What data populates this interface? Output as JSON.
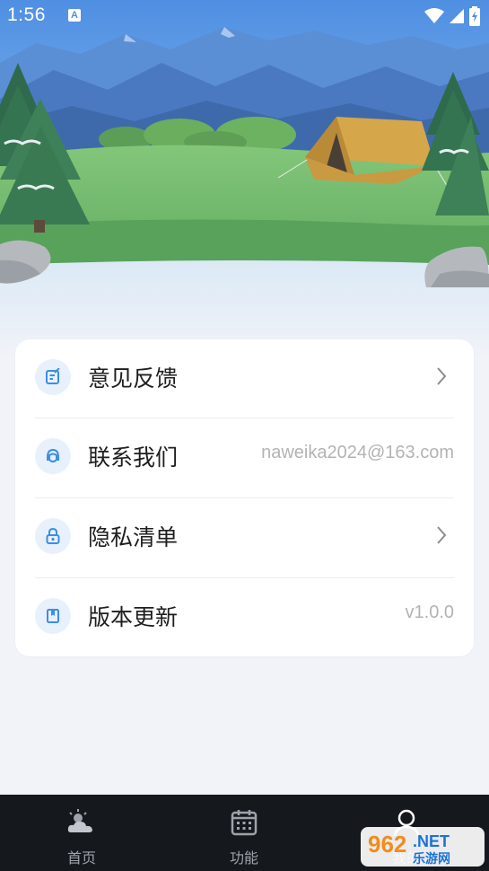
{
  "status": {
    "time": "1:56",
    "badge": "A"
  },
  "settings": {
    "items": [
      {
        "label": "意见反馈",
        "value": "",
        "icon": "feedback-edit-icon",
        "chevron": true
      },
      {
        "label": "联系我们",
        "value": "naweika2024@163.com",
        "icon": "contact-headset-icon",
        "chevron": false
      },
      {
        "label": "隐私清单",
        "value": "",
        "icon": "privacy-lock-icon",
        "chevron": true
      },
      {
        "label": "版本更新",
        "value": "v1.0.0",
        "icon": "version-bookmark-icon",
        "chevron": false
      }
    ]
  },
  "nav": {
    "items": [
      {
        "label": "首页",
        "icon": "weather-cloud-sun-icon"
      },
      {
        "label": "功能",
        "icon": "calendar-icon"
      },
      {
        "label": "我的",
        "icon": "profile-person-icon"
      }
    ]
  },
  "watermark": {
    "brand": "962.NET",
    "sub": "乐游网"
  },
  "colors": {
    "accent": "#3a8ee6",
    "icon_bg": "#e8f0fb",
    "nav_bg": "#15181d",
    "page_bg": "#f1f3f8"
  }
}
